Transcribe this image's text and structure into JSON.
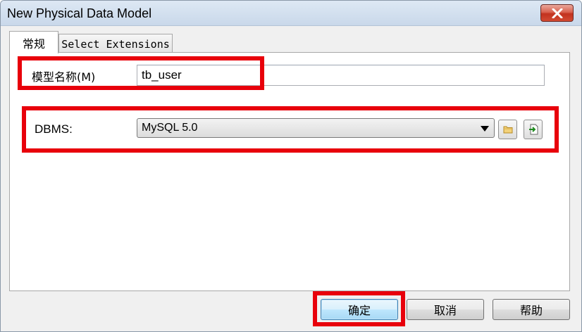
{
  "window": {
    "title": "New Physical Data Model",
    "close_icon": "close-icon"
  },
  "tabs": [
    {
      "label": "常规",
      "active": true
    },
    {
      "label": "Select Extensions",
      "active": false
    }
  ],
  "form": {
    "model_name_label": "模型名称(M)",
    "model_name_value": "tb_user",
    "dbms_label": "DBMS:",
    "dbms_value": "MySQL 5.0",
    "dbms_arrow_icon": "chevron-down-icon",
    "browse_icon": "folder-icon",
    "import_icon": "import-icon"
  },
  "buttons": {
    "ok": "确定",
    "cancel": "取消",
    "help": "帮助"
  },
  "colors": {
    "highlight": "#e8000b",
    "ok_border": "#3c7fb1"
  }
}
